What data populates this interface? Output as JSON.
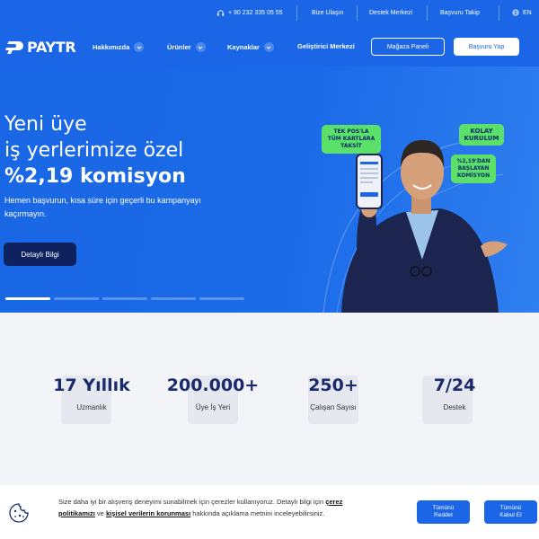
{
  "topbar": {
    "phone": "+ 90 232 335 05 55",
    "links": [
      "Bize Ulaşın",
      "Destek Merkezi",
      "Başvuru Takip"
    ],
    "lang": "EN"
  },
  "nav": {
    "logo": "PAYTR",
    "items": [
      "Hakkımızda",
      "Ürünler",
      "Kaynaklar",
      "Geliştirici Merkezi"
    ],
    "store_panel": "Mağaza Paneli",
    "apply": "Başvuru Yap"
  },
  "hero": {
    "title_line1": "Yeni üye",
    "title_line2": "iş yerlerimize özel",
    "title_line3": "%2,19 komisyon",
    "subtitle": "Hemen başvurun, kısa süre için geçerli bu kampanyayı kaçırmayın.",
    "button": "Detaylı Bilgi",
    "slide_count": 5,
    "active_slide": 1,
    "bubbles": {
      "b1": "TEK POS'LA TÜM KARTLARA TAKSİT",
      "b2": "KOLAY KURULUM",
      "b3": "%2,19'DAN BAŞLAYAN KOMİSYON"
    },
    "phone_brand": "PAYTR"
  },
  "stats": [
    {
      "num": "17 Yıllık",
      "label": "Uzmanlık"
    },
    {
      "num": "200.000+",
      "label": "Üye İş Yeri"
    },
    {
      "num": "250+",
      "label": "Çalışan Sayısı"
    },
    {
      "num": "7/24",
      "label": "Destek"
    }
  ],
  "cookie": {
    "text_before": "Size daha iyi bir alışveriş deneyimi sunabilmek için çerezler kullanıyoruz. Detaylı bilgi için ",
    "link1": "çerez politikamızı",
    "text_mid": " ve ",
    "link2": "kişisel verilerin korunması",
    "text_after": " hakkında açıklama metnini inceleyebilirsiniz.",
    "reject": "Tümünü Reddet",
    "accept": "Tümünü Kabul Et"
  },
  "colors": {
    "brand_blue": "#1a66e6",
    "navy": "#0e2260",
    "accent_green": "#5be06a"
  }
}
